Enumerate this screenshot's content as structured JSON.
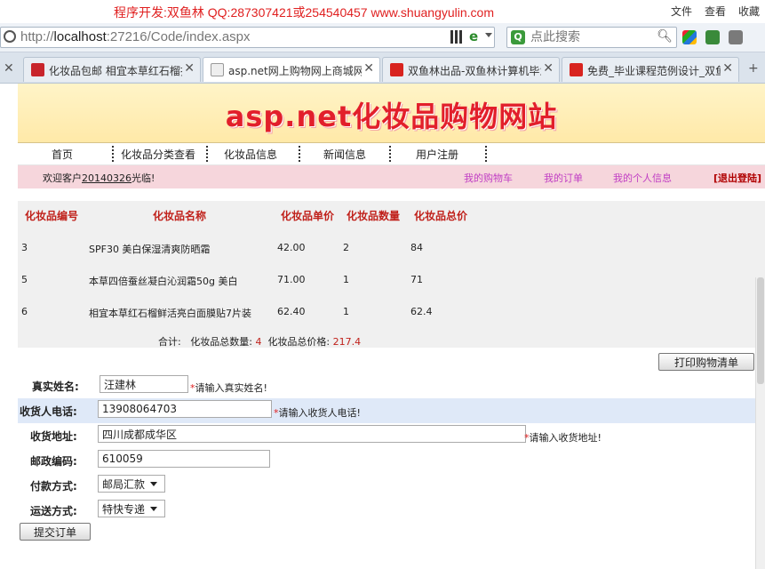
{
  "watermark": {
    "text": "程序开发:双鱼林 QQ:287307421或254540457 www.shuangyulin.com"
  },
  "browser": {
    "menu": [
      "文件",
      "查看",
      "收藏"
    ],
    "address": {
      "prefix": "http://",
      "host": "localhost",
      "rest": ":27216/Code/index.aspx"
    },
    "search": {
      "placeholder": "点此搜索"
    },
    "tabs": [
      {
        "label": "化妆品包邮 相宜本草红石榴护",
        "color": "#c8252c"
      },
      {
        "label": "asp.net网上购物网上商城网站",
        "color": "#dddddd"
      },
      {
        "label": "双鱼林出品-双鱼林计算机毕业",
        "color": "#d8231f"
      },
      {
        "label": "免费_毕业课程范例设计_双鱼",
        "color": "#d8231f"
      }
    ]
  },
  "site": {
    "title": "asp.net化妆品购物网站",
    "nav": [
      "首页",
      "化妆品分类查看",
      "化妆品信息",
      "新闻信息",
      "用户注册"
    ],
    "welcome": {
      "prefix": "欢迎客户",
      "user": "20140326",
      "suffix": "光临!"
    },
    "links": [
      "我的购物车",
      "我的订单",
      "我的个人信息"
    ],
    "logout": "[退出登陆]"
  },
  "cart": {
    "headers": [
      "化妆品编号",
      "化妆品名称",
      "化妆品单价",
      "化妆品数量",
      "化妆品总价"
    ],
    "rows": [
      {
        "id": "3",
        "name": "SPF30 美白保湿清爽防晒霜",
        "price": "42.00",
        "qty": "2",
        "total": "84"
      },
      {
        "id": "5",
        "name": "本草四倍蚕丝凝白沁润霜50g 美白",
        "price": "71.00",
        "qty": "1",
        "total": "71"
      },
      {
        "id": "6",
        "name": "相宜本草红石榴鲜活亮白面膜贴7片装",
        "price": "62.40",
        "qty": "1",
        "total": "62.4"
      }
    ],
    "summary": {
      "label": "合计:",
      "count_label": "化妆品总数量:",
      "count": "4",
      "price_label": "化妆品总价格:",
      "price": "217.4"
    },
    "print_button": "打印购物清单"
  },
  "form": {
    "name": {
      "label": "真实姓名:",
      "value": "汪建林",
      "hint": "请输入真实姓名!"
    },
    "phone": {
      "label": "收货人电话:",
      "value": "13908064703",
      "hint": "请输入收货人电话!"
    },
    "address": {
      "label": "收货地址:",
      "value": "四川成都成华区",
      "hint": "请输入收货地址!"
    },
    "zip": {
      "label": "邮政编码:",
      "value": "610059"
    },
    "payment": {
      "label": "付款方式:",
      "value": "邮局汇款"
    },
    "shipping": {
      "label": "运送方式:",
      "value": "特快专递"
    },
    "submit": "提交订单"
  },
  "colors": {
    "accent_red": "#c0211b",
    "title_red": "#e21f2b",
    "link_purple": "#c03ec4",
    "welcome_bg": "#f6d6dc",
    "banner_bg": "#ffe9a8"
  }
}
